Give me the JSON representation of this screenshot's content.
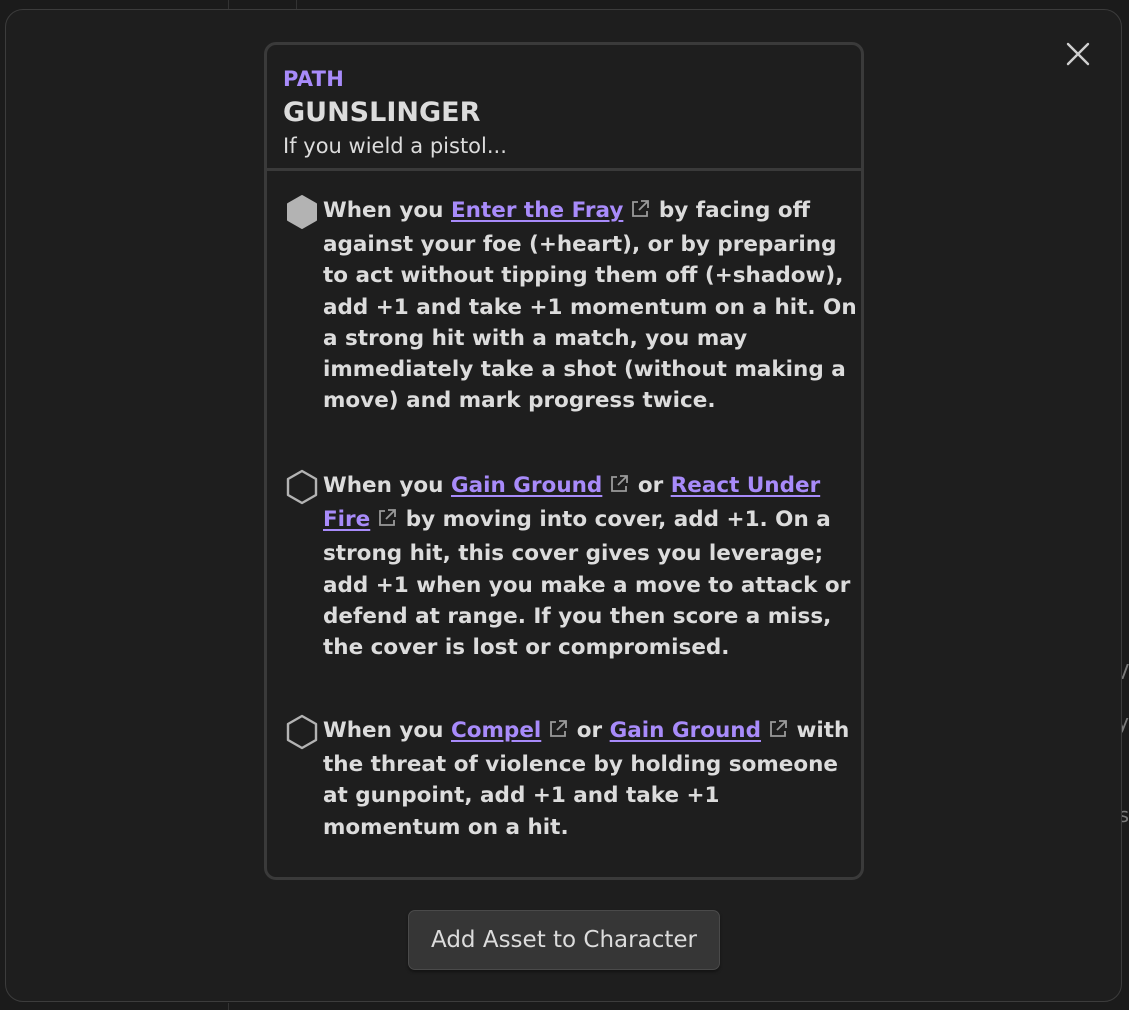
{
  "modal": {
    "close_icon": "close-icon"
  },
  "asset": {
    "category": "PATH",
    "name": "GUNSLINGER",
    "requirement": "If you wield a pistol...",
    "abilities": [
      {
        "enabled": true,
        "parts": [
          {
            "type": "text",
            "value": "When you "
          },
          {
            "type": "link",
            "value": "Enter the Fray"
          },
          {
            "type": "text",
            "value": " by facing off against your foe (+heart), or by preparing to act without tipping them off (+shadow), add +1 and take +1 momentum on a hit. On a strong hit with a match, you may immediately take a shot (without making a move) and mark progress twice."
          }
        ]
      },
      {
        "enabled": false,
        "parts": [
          {
            "type": "text",
            "value": "When you "
          },
          {
            "type": "link",
            "value": "Gain Ground"
          },
          {
            "type": "text",
            "value": " or "
          },
          {
            "type": "link",
            "value": "React Under Fire"
          },
          {
            "type": "text",
            "value": " by moving into cover, add +1. On a strong hit, this cover gives you leverage; add +1 when you make a move to attack or defend at range. If you then score a miss, the cover is lost or compromised."
          }
        ]
      },
      {
        "enabled": false,
        "parts": [
          {
            "type": "text",
            "value": "When you "
          },
          {
            "type": "link",
            "value": "Compel"
          },
          {
            "type": "text",
            "value": " or "
          },
          {
            "type": "link",
            "value": "Gain Ground"
          },
          {
            "type": "text",
            "value": " with the threat of violence by holding someone at gunpoint, add +1 and take +1 momentum on a hit."
          }
        ]
      }
    ]
  },
  "actions": {
    "add_label": "Add Asset to Character"
  },
  "background": {
    "glyph_1": "V",
    "glyph_2": "y",
    "glyph_3": "s"
  },
  "colors": {
    "accent": "#a88bfa",
    "text": "#dcdcdc",
    "surface": "#1e1e1e",
    "border": "#3a3a3a",
    "marker_filled": "#b3b3b3",
    "marker_outline": "#b3b3b3"
  }
}
